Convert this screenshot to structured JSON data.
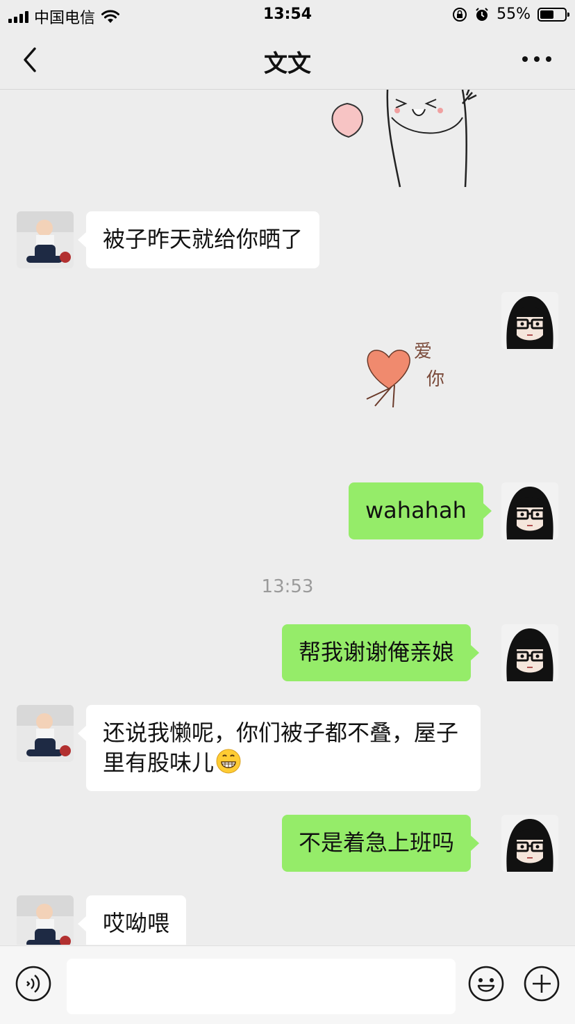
{
  "status_bar": {
    "carrier": "中国电信",
    "time": "13:54",
    "battery_text": "55%",
    "battery_level": 0.55
  },
  "nav": {
    "title": "文文",
    "back_icon": "chevron-left-icon",
    "more_icon": "more-dots-icon"
  },
  "messages": [
    {
      "from": "contact",
      "type": "text",
      "text": "被子昨天就给你晒了"
    },
    {
      "from": "me",
      "type": "sticker",
      "sticker_text_1": "爱",
      "sticker_text_2": "你"
    },
    {
      "from": "me",
      "type": "text",
      "text": "wahahah"
    },
    {
      "type": "time",
      "text": "13:53"
    },
    {
      "from": "me",
      "type": "text",
      "text": "帮我谢谢俺亲娘"
    },
    {
      "from": "contact",
      "type": "text",
      "text": "还说我懒呢，你们被子都不叠，屋子里有股味儿",
      "emoji": "grin-emoji"
    },
    {
      "from": "me",
      "type": "text",
      "text": "不是着急上班吗"
    },
    {
      "from": "contact",
      "type": "text",
      "text": "哎呦喂"
    }
  ],
  "input_bar": {
    "voice_icon": "voice-icon",
    "emoji_icon": "emoji-icon",
    "plus_icon": "plus-icon",
    "message_value": ""
  },
  "colors": {
    "background": "#ededed",
    "my_bubble": "#95ec69",
    "their_bubble": "#ffffff",
    "timestamp_text": "#9a9a9a"
  }
}
